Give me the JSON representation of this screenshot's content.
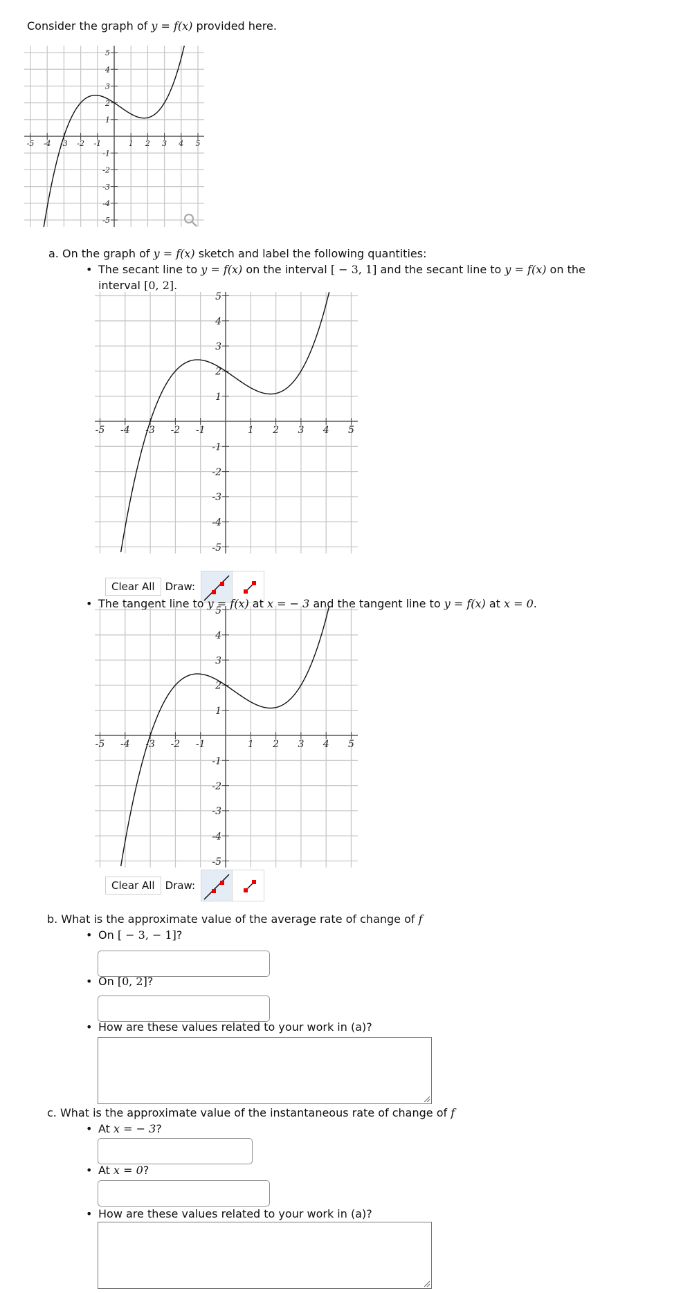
{
  "intro": {
    "prefix": "Consider the graph of ",
    "math": "y = f(x)",
    "suffix": " provided here."
  },
  "graph_icons": {
    "zoom": "magnifier-icon"
  },
  "part_a": {
    "label": "a. On the graph of ",
    "math": "y = f(x)",
    "suffix": " sketch and label the following quantities:",
    "item1": {
      "t1": "The secant line to ",
      "m1": "y = f(x)",
      "t2": " on the interval ",
      "m2": "[ − 3, 1]",
      "t3": " and the secant line to ",
      "m3": "y = f(x)",
      "t4": " on the",
      "t5": "interval ",
      "m4": "[0, 2]",
      "t6": "."
    },
    "item2": {
      "t1": "The tangent line to ",
      "m1": "y = f(x)",
      "t2": " at ",
      "m2": "x =  − 3",
      "t3": " and the tangent line to ",
      "m3": "y = f(x)",
      "t4": " at ",
      "m4": "x = 0",
      "t5": "."
    },
    "toolbar": {
      "clear_label": "Clear All",
      "draw_label": "Draw:",
      "tools": [
        {
          "name": "line-tool",
          "icon": "line-icon",
          "active": true
        },
        {
          "name": "segment-tool",
          "icon": "segment-icon",
          "active": false
        }
      ]
    }
  },
  "part_b": {
    "label": "b. What is the approximate value of the average rate of change of ",
    "math": "f",
    "q1": {
      "prefix": "On ",
      "math": "[ − 3,  − 1]",
      "suffix": "?",
      "value": ""
    },
    "q2": {
      "prefix": "On ",
      "math": "[0, 2]",
      "suffix": "?",
      "value": ""
    },
    "q3": {
      "text": "How are these values related to your work in (a)?",
      "value": ""
    }
  },
  "part_c": {
    "label": "c. What is the approximate value of the instantaneous rate of change of ",
    "math": "f",
    "q1": {
      "prefix": "At ",
      "math": "x =  − 3",
      "suffix": "?",
      "value": ""
    },
    "q2": {
      "prefix": "At ",
      "math": "x = 0",
      "suffix": "?",
      "value": ""
    },
    "q3": {
      "text": "How are these values related to your work in (a)?",
      "value": ""
    }
  },
  "chart_data": {
    "type": "line",
    "title": "",
    "xlabel": "",
    "ylabel": "",
    "xlim": [
      -5,
      5
    ],
    "ylim": [
      -5,
      5
    ],
    "grid": true,
    "x_ticks": [
      "-5",
      "-4",
      "-3",
      "-2",
      "-1",
      "1",
      "2",
      "3",
      "4",
      "5"
    ],
    "y_ticks": [
      "5",
      "4",
      "3",
      "2",
      "1",
      "-1",
      "-2",
      "-3",
      "-4",
      "-5"
    ],
    "series": [
      {
        "name": "f(x)",
        "x": [
          -4.15,
          -4,
          -3.5,
          -3,
          -2.5,
          -2,
          -1.5,
          -1,
          -0.5,
          0,
          0.5,
          1,
          1.5,
          1.8,
          2,
          2.5,
          3,
          3.5,
          4,
          4.15
        ],
        "values": [
          -4.6,
          -4.22,
          -1.89,
          0,
          1.31,
          2,
          2.25,
          2.44,
          2.36,
          2,
          1.78,
          1.33,
          1.19,
          1.1,
          1.11,
          1.31,
          2,
          3.07,
          4.67,
          5.2
        ]
      }
    ]
  }
}
